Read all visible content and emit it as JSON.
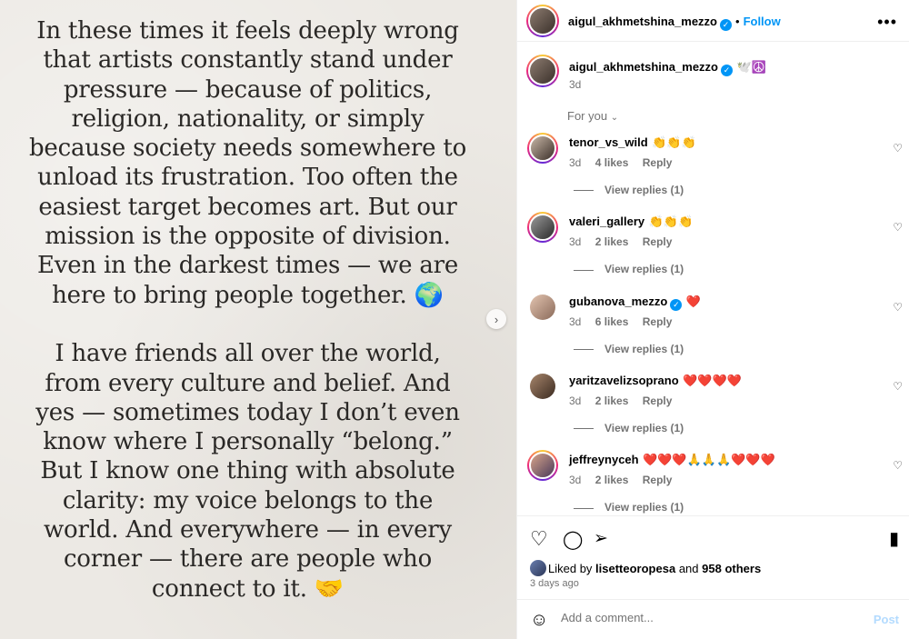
{
  "post": {
    "text": "In these times it feels deeply wrong that artists constantly stand under pressure — because of politics, religion, nationality, or simply because society needs somewhere to unload its frustration. Too often the easiest target becomes art. But our mission is the opposite of division. Even in the darkest times — we are here to bring people together. 🌍\n\nI have friends all over the world, from every culture and belief. And yes — sometimes today I don’t even know where I personally “belong.” But I know one thing with absolute clarity: my voice belongs to the world. And everywhere — in every corner — there are people who connect to it. 🤝"
  },
  "header": {
    "username": "aigul_akhmetshina_mezzo",
    "separator": "•",
    "follow_label": "Follow",
    "more_icon": "more-horizontal-icon"
  },
  "caption": {
    "username": "aigul_akhmetshina_mezzo",
    "text": "🕊️☮️",
    "time": "3d"
  },
  "sort": {
    "label": "For you",
    "icon": "chevron-down-icon"
  },
  "comments": [
    {
      "username": "tenor_vs_wild",
      "text": "👏👏👏",
      "verified": false,
      "time": "3d",
      "likes": "4 likes",
      "reply": "Reply",
      "view_replies": "View replies (1)"
    },
    {
      "username": "valeri_gallery",
      "text": "👏👏👏",
      "verified": false,
      "time": "3d",
      "likes": "2 likes",
      "reply": "Reply",
      "view_replies": "View replies (1)"
    },
    {
      "username": "gubanova_mezzo",
      "text": "❤️",
      "verified": true,
      "time": "3d",
      "likes": "6 likes",
      "reply": "Reply",
      "view_replies": "View replies (1)"
    },
    {
      "username": "yaritzavelizsoprano",
      "text": "❤️❤️❤️❤️",
      "verified": false,
      "time": "3d",
      "likes": "2 likes",
      "reply": "Reply",
      "view_replies": "View replies (1)"
    },
    {
      "username": "jeffreynyceh",
      "text": "❤️❤️❤️🙏🙏🙏❤️❤️❤️",
      "verified": false,
      "time": "3d",
      "likes": "2 likes",
      "reply": "Reply",
      "view_replies": "View replies (1)"
    }
  ],
  "actions": {
    "liked_by_prefix": "Liked by",
    "liked_by_user": "lisetteoropesa",
    "liked_by_and": "and",
    "liked_by_others": "958 others",
    "time_ago": "3 days ago"
  },
  "add_comment": {
    "placeholder": "Add a comment...",
    "post_label": "Post"
  },
  "colors": {
    "accent": "#0095f6",
    "muted": "#737373",
    "post_disabled": "#b3dbff"
  }
}
